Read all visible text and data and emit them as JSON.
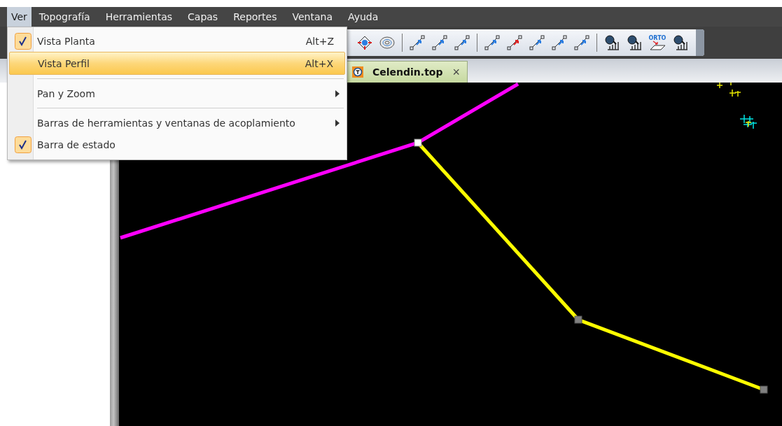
{
  "menu_bar": [
    {
      "label": "Ver",
      "selected": true
    },
    {
      "label": "Topografía",
      "selected": false
    },
    {
      "label": "Herramientas",
      "selected": false
    },
    {
      "label": "Capas",
      "selected": false
    },
    {
      "label": "Reportes",
      "selected": false
    },
    {
      "label": "Ventana",
      "selected": false
    },
    {
      "label": "Ayuda",
      "selected": false
    }
  ],
  "dropdown": [
    {
      "kind": "item",
      "label": "Vista Planta",
      "shortcut": "Alt+Z",
      "checked": true,
      "selected": false,
      "submenu": false
    },
    {
      "kind": "item",
      "label": "Vista Perfil",
      "shortcut": "Alt+X",
      "checked": false,
      "selected": true,
      "submenu": false
    },
    {
      "kind": "separator"
    },
    {
      "kind": "item",
      "label": "Pan y Zoom",
      "checked": false,
      "selected": false,
      "submenu": true
    },
    {
      "kind": "separator"
    },
    {
      "kind": "item",
      "label": "Barras de herramientas y ventanas de acoplamiento",
      "checked": false,
      "selected": false,
      "submenu": true
    },
    {
      "kind": "item",
      "label": "Barra de estado",
      "checked": true,
      "selected": false,
      "submenu": false
    }
  ],
  "toolbar": {
    "ortho_icon_label": "ORTO"
  },
  "tabs": [
    {
      "label": "Celendin.top",
      "selected": true,
      "close": "×"
    }
  ]
}
